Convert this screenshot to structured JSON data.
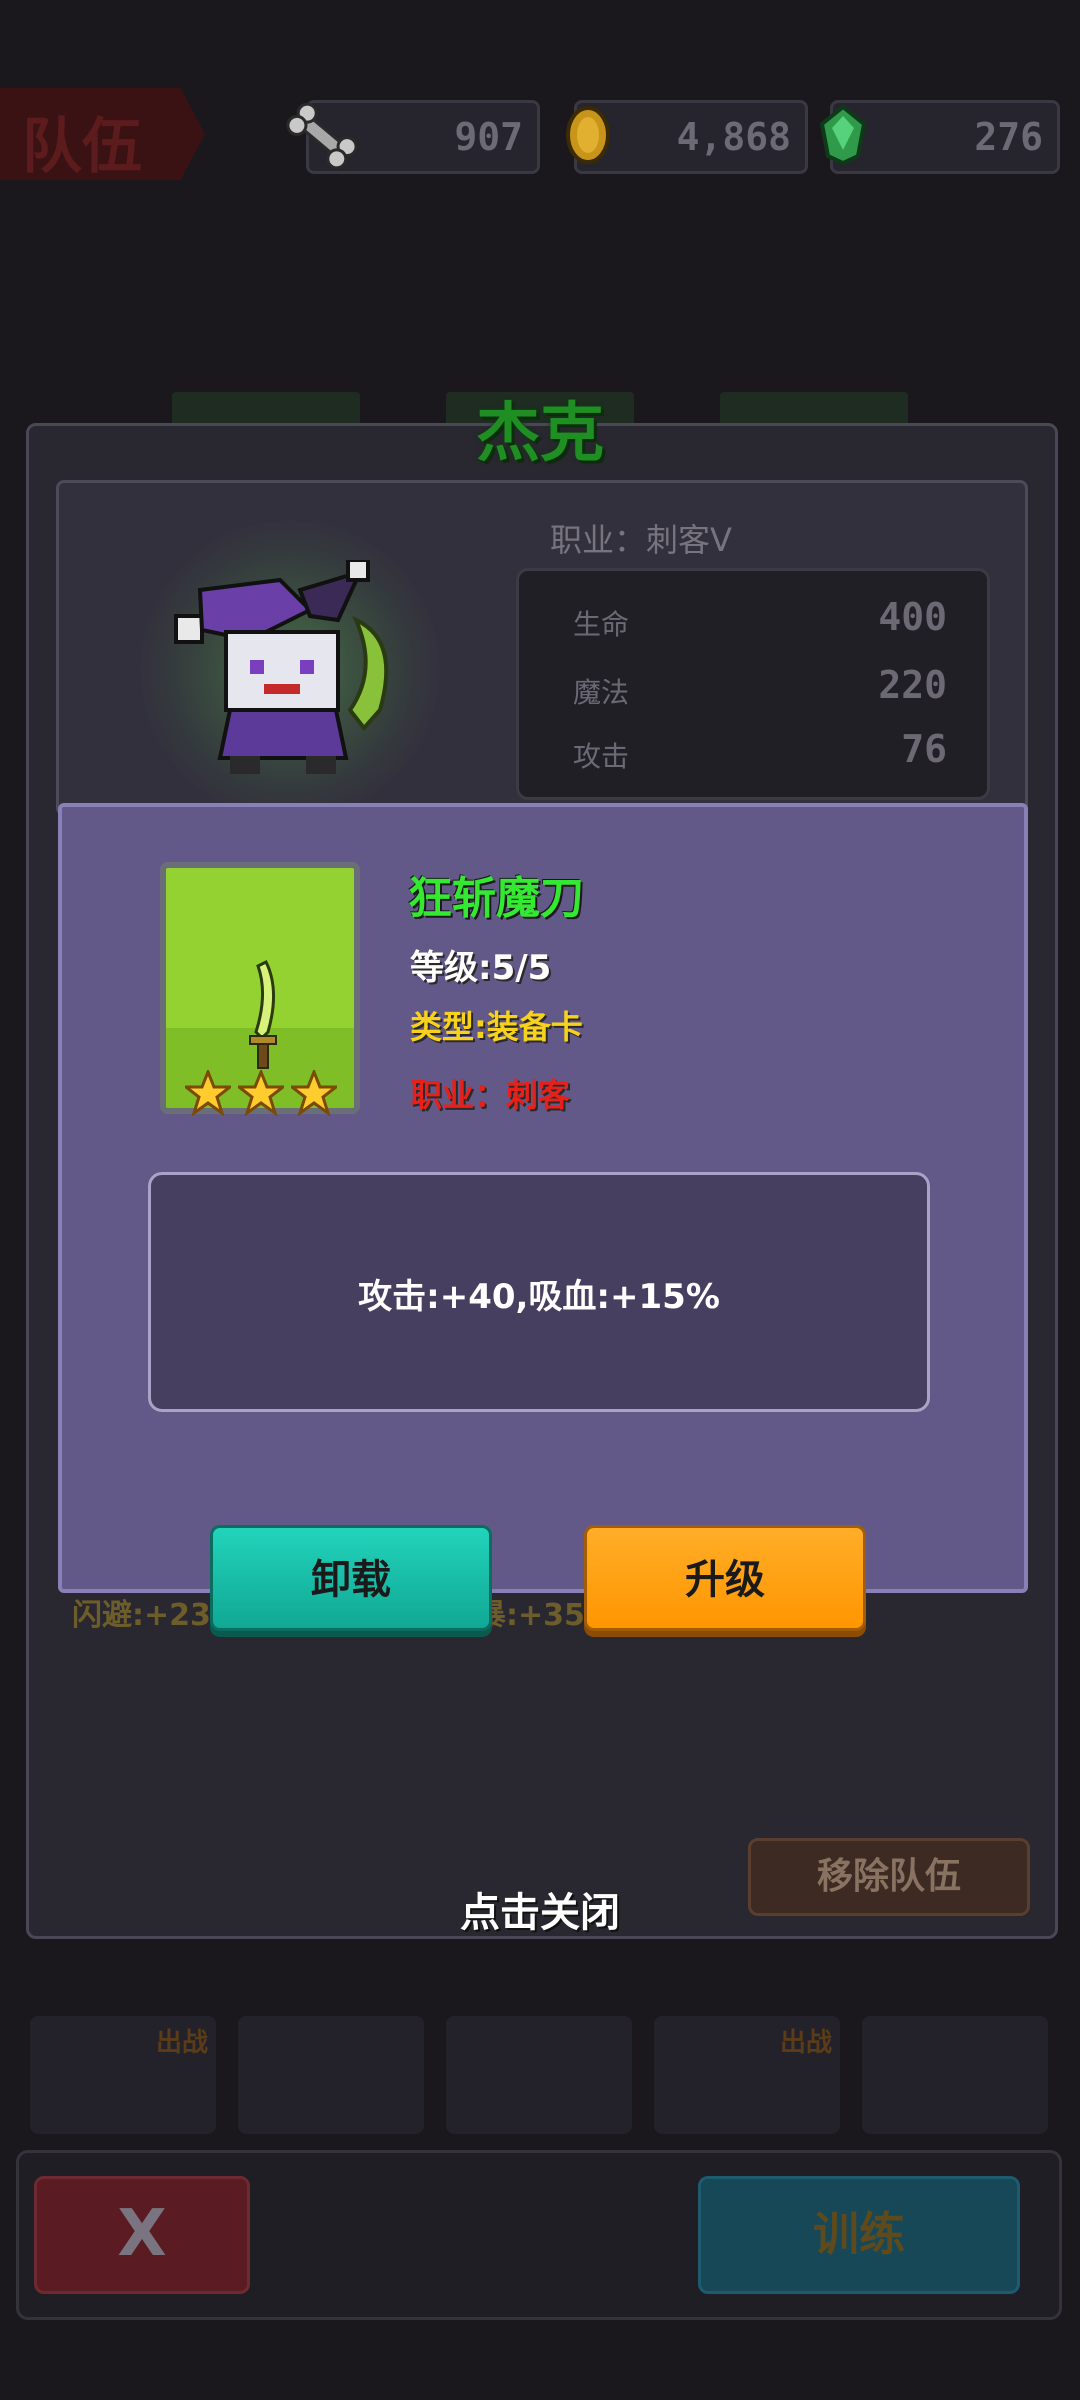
{
  "top_bar": {
    "team_label": "队伍",
    "resources": [
      {
        "icon": "bone-icon",
        "value": "907"
      },
      {
        "icon": "gold-coin-icon",
        "value": "4,868"
      },
      {
        "icon": "green-gem-icon",
        "value": "276"
      }
    ]
  },
  "hero": {
    "name": "杰克",
    "class_line": "职业：刺客Ⅴ",
    "stats": [
      {
        "label": "生命",
        "value": "400"
      },
      {
        "label": "魔法",
        "value": "220"
      },
      {
        "label": "攻击",
        "value": "76"
      }
    ]
  },
  "item": {
    "name": "狂斩魔刀",
    "level": "等级:5/5",
    "type": "类型:装备卡",
    "job": "职业：刺客",
    "stars": 3,
    "description": "攻击:+40,吸血:+15%"
  },
  "buttons": {
    "unload": "卸载",
    "upgrade": "升级",
    "remove_team": "移除队伍",
    "close_hint": "点击关闭",
    "exit": "X",
    "train": "训练"
  },
  "background_stats": {
    "dodge": "闪避:+23",
    "other": "暴:+350"
  },
  "slot_tags": [
    "出战",
    "出战"
  ],
  "colors": {
    "hero_name": "#1f8f24",
    "item_name": "#35e832",
    "item_type": "#f7d11c",
    "item_job": "#e8201a",
    "popup_bg": "#635989",
    "unload_button": "#16c2a8",
    "upgrade_button": "#ff9e14"
  }
}
